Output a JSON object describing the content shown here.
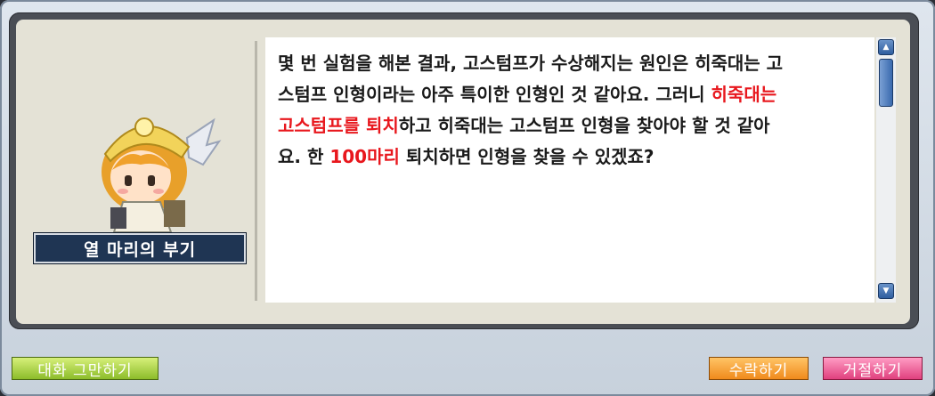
{
  "dialog": {
    "npc_name": "열 마리의 부기",
    "message": {
      "line1": "몇 번 실험을 해본 결과, 고스텀프가 수상해지는 원인은 히죽대는 고",
      "line2_a": "스텀프 인형이라는 아주 특이한 인형인 것 같아요. 그러니 ",
      "line2_b": "히죽대는",
      "line3_a": "고스텀프를 퇴치",
      "line3_b": "하고 히죽대는 고스텀프 인형을 찾아야 할 것 같아",
      "line4_a": "요. 한 ",
      "line4_b": "100마리",
      "line4_c": " 퇴치하면 인형을 찾을 수 있겠죠?"
    }
  },
  "buttons": {
    "end_chat": "대화 그만하기",
    "accept": "수락하기",
    "decline": "거절하기"
  },
  "colors": {
    "highlight": "#e8171d",
    "name_plate": "#1f3553"
  }
}
